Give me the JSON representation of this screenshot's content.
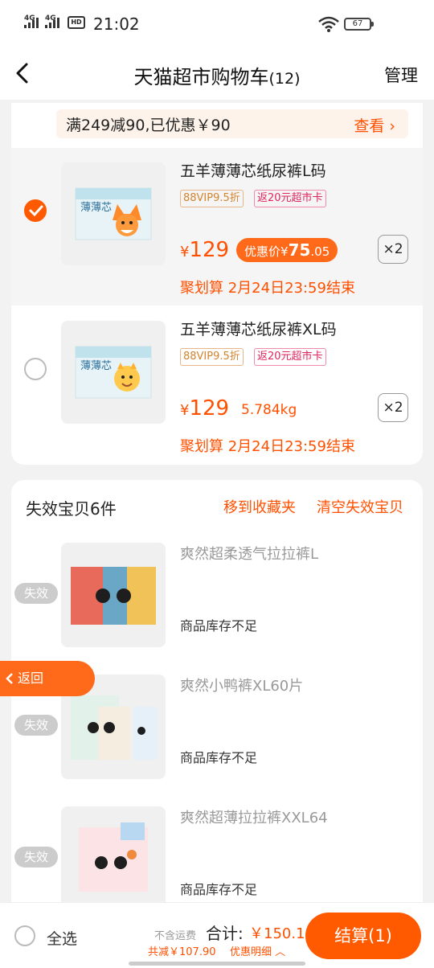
{
  "status_bar": {
    "net1": "4G",
    "net2": "4G",
    "hd": "HD",
    "time": "21:02",
    "battery": "67"
  },
  "nav": {
    "title": "天猫超市购物车",
    "count": "(12)",
    "manage": "管理"
  },
  "promo": {
    "text": "满249减90,已优惠￥90",
    "link": "查看"
  },
  "cart_items": [
    {
      "title": "五羊薄薄芯纸尿裤L码",
      "tag_vip": "88VIP9.5折",
      "tag_card": "返20元超市卡",
      "price": "129",
      "deal_label": "优惠价",
      "deal_price_int": "75",
      "deal_price_dec": ".05",
      "qty": "×2",
      "jhs": "聚划算 2月24日23:59结束"
    },
    {
      "title": "五羊薄薄芯纸尿裤XL码",
      "tag_vip": "88VIP9.5折",
      "tag_card": "返20元超市卡",
      "price": "129",
      "weight": "5.784kg",
      "qty": "×2",
      "jhs": "聚划算 2月24日23:59结束"
    }
  ],
  "invalid": {
    "title": "失效宝贝6件",
    "move_fav": "移到收藏夹",
    "clear": "清空失效宝贝",
    "badge": "失效",
    "items": [
      {
        "title": "爽然超柔透气拉拉裤L",
        "stock": "商品库存不足"
      },
      {
        "title": "爽然小鸭裤XL60片",
        "stock": "商品库存不足"
      },
      {
        "title": "爽然超薄拉拉裤XXL64",
        "stock": "商品库存不足"
      }
    ]
  },
  "float_back": "返回",
  "footer": {
    "select_all": "全选",
    "shipping": "不含运费",
    "total_label": "合计:",
    "total": "￥150.1",
    "saved": "共减￥107.90",
    "detail": "优惠明细",
    "checkout": "结算(1)"
  },
  "colors": {
    "accent": "#ff5000",
    "checkout": "#ff5a00"
  }
}
